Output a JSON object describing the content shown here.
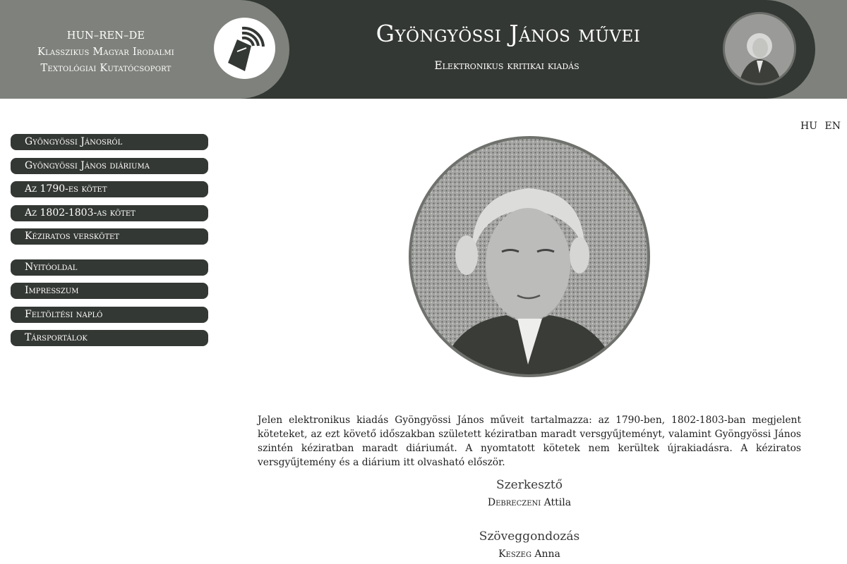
{
  "header": {
    "org_lines": [
      "HUN–REN–DE",
      "Klasszikus Magyar Irodalmi",
      "Textológiai Kutatócsoport"
    ],
    "title": "Gyöngyössi János művei",
    "subtitle": "Elektronikus kritikai kiadás"
  },
  "nav": {
    "primary": [
      {
        "label": "Gyöngyössi Jánosról"
      },
      {
        "label": "Gyöngyössi János diáriuma"
      },
      {
        "label": "Az 1790-es kötet"
      },
      {
        "label": "Az 1802-1803-as kötet"
      },
      {
        "label": "Kéziratos verskötet"
      }
    ],
    "secondary": [
      {
        "label": "Nyitóoldal"
      },
      {
        "label": "Impresszum"
      },
      {
        "label": "Feltöltési napló"
      },
      {
        "label": "Társportálok"
      }
    ]
  },
  "lang": {
    "hu": "HU",
    "en": "EN"
  },
  "intro": "Jelen elektronikus kiadás Gyöngyössi János műveit tartalmazza: az 1790-ben, 1802-1803-ban megjelent köteteket, az ezt követő időszakban született kéziratban maradt versgyűjteményt, valamint Gyöngyössi János szintén kéziratban maradt diáriumát. A nyomtatott kötetek nem kerültek újrakiadásra. A kéziratos versgyűjtemény és a diárium itt olvasható először.",
  "credits": [
    {
      "role": "Szerkesztő",
      "name_sc": "Debreczeni",
      "name_rest": "Attila"
    },
    {
      "role": "Szöveggondozás",
      "name_sc": "Keszeg",
      "name_rest": "Anna"
    }
  ],
  "colors": {
    "dark": "#343834",
    "grey": "#7f827c",
    "white": "#ffffff"
  },
  "icons": {
    "logo": "book-signal-icon"
  }
}
